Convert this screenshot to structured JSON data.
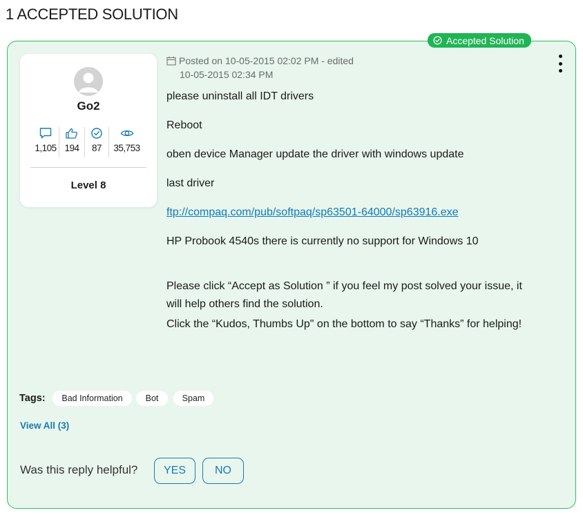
{
  "page": {
    "heading": "1 ACCEPTED SOLUTION"
  },
  "badge": {
    "label": "Accepted Solution",
    "color": "#21b457",
    "icon": "check-circle-icon"
  },
  "author": {
    "name": "Go2",
    "stats": [
      {
        "icon": "comment-icon",
        "value": "1,105"
      },
      {
        "icon": "thumbs-up-icon",
        "value": "194"
      },
      {
        "icon": "check-circle-icon",
        "value": "87"
      },
      {
        "icon": "eye-icon",
        "value": "35,753"
      }
    ],
    "level": "Level 8"
  },
  "post": {
    "posted": "Posted on 10-05-2015 02:02 PM - edited",
    "edited": "10-05-2015 02:34 PM",
    "lines": [
      "please uninstall all IDT drivers",
      "Reboot",
      "oben device Manager update the driver with windows update",
      "last  driver",
      "ftp://compaq.com/pub/softpaq/sp63501-64000/sp63916.exe",
      "HP Probook 4540s there is currently no support for Windows 10",
      "Please click “Accept as Solution ” if you feel my post solved your issue, it",
      "will help others find the solution.",
      "Click the “Kudos, Thumbs Up\" on the bottom to say “Thanks” for helping!"
    ]
  },
  "tags": {
    "label": "Tags:",
    "items": [
      "Bad Information",
      "Bot",
      "Spam"
    ],
    "view_all": "View All (3)"
  },
  "feedback": {
    "question": "Was this reply helpful?",
    "yes": "YES",
    "no": "NO"
  },
  "colors": {
    "card_bg": "#e8f6ee",
    "card_border": "#2bbf5c",
    "link": "#1a7ab0"
  }
}
